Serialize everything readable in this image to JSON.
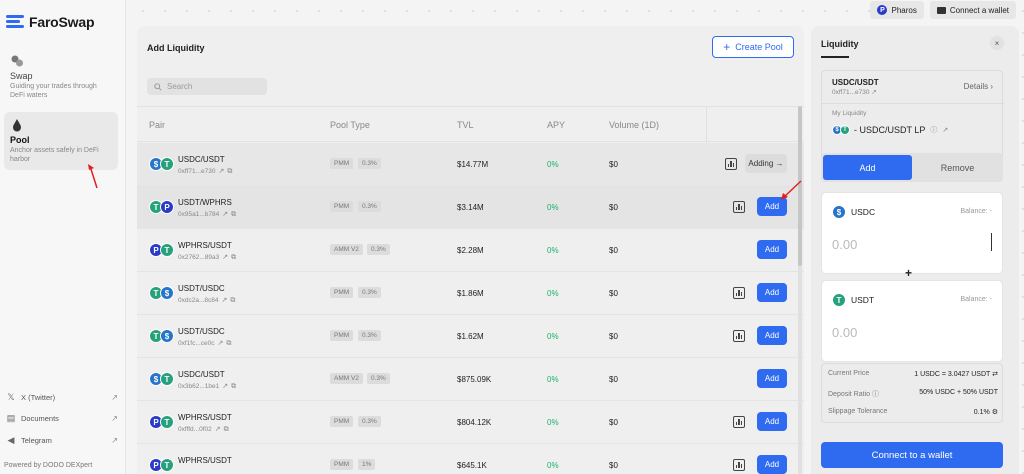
{
  "brand": {
    "name": "FaroSwap"
  },
  "sidebar": {
    "nav": [
      {
        "title": "Swap",
        "desc": "Guiding your trades through DeFi waters"
      },
      {
        "title": "Pool",
        "desc": "Anchor assets safely in DeFi harbor"
      }
    ],
    "links": [
      {
        "label": "X (Twitter)",
        "icon": "x-icon"
      },
      {
        "label": "Documents",
        "icon": "document-icon"
      },
      {
        "label": "Telegram",
        "icon": "telegram-icon"
      }
    ],
    "powered": "Powered by DODO DEXpert"
  },
  "topbar": {
    "network": "Pharos",
    "connect": "Connect a wallet"
  },
  "main": {
    "title": "Add Liquidity",
    "create_pool": "Create Pool",
    "search_placeholder": "Search",
    "columns": {
      "pair": "Pair",
      "pool_type": "Pool Type",
      "tvl": "TVL",
      "apy": "APY",
      "volume": "Volume (1D)"
    },
    "rows": [
      {
        "pair": "USDC/USDT",
        "addr": "0xff71...e730",
        "type": "PMM",
        "fee": "0.3%",
        "tvl": "$14.77M",
        "apy": "0%",
        "vol": "$0",
        "action": "Adding →"
      },
      {
        "pair": "USDT/WPHRS",
        "addr": "0x95a1...b784",
        "type": "PMM",
        "fee": "0.3%",
        "tvl": "$3.14M",
        "apy": "0%",
        "vol": "$0",
        "action": "Add"
      },
      {
        "pair": "WPHRS/USDT",
        "addr": "0x2762...89a3",
        "type": "AMM V2",
        "fee": "0.3%",
        "tvl": "$2.28M",
        "apy": "0%",
        "vol": "$0",
        "action": "Add"
      },
      {
        "pair": "USDT/USDC",
        "addr": "0xdc2a...8c84",
        "type": "PMM",
        "fee": "0.3%",
        "tvl": "$1.86M",
        "apy": "0%",
        "vol": "$0",
        "action": "Add"
      },
      {
        "pair": "USDT/USDC",
        "addr": "0xf1fc...ce0c",
        "type": "PMM",
        "fee": "0.3%",
        "tvl": "$1.62M",
        "apy": "0%",
        "vol": "$0",
        "action": "Add"
      },
      {
        "pair": "USDC/USDT",
        "addr": "0x3b62...1be1",
        "type": "AMM V2",
        "fee": "0.3%",
        "tvl": "$875.09K",
        "apy": "0%",
        "vol": "$0",
        "action": "Add"
      },
      {
        "pair": "WPHRS/USDT",
        "addr": "0xfffd...0f02",
        "type": "PMM",
        "fee": "0.3%",
        "tvl": "$804.12K",
        "apy": "0%",
        "vol": "$0",
        "action": "Add"
      },
      {
        "pair": "WPHRS/USDT",
        "addr": "",
        "type": "PMM",
        "fee": "1%",
        "tvl": "$645.1K",
        "apy": "0%",
        "vol": "$0",
        "action": "Add"
      }
    ]
  },
  "liquidity": {
    "title": "Liquidity",
    "close": "×",
    "pool_name": "USDC/USDT",
    "pool_addr": "0xff71...e730",
    "details": "Details ›",
    "my_liquidity_label": "My Liquidity",
    "lp_label": "- USDC/USDT LP",
    "tab_add": "Add",
    "tab_remove": "Remove",
    "token_a": {
      "symbol": "USDC",
      "balance": "Balance: -",
      "amount": "0.00"
    },
    "plus": "+",
    "token_b": {
      "symbol": "USDT",
      "balance": "Balance: -",
      "amount": "0.00"
    },
    "current_price_label": "Current Price",
    "current_price": "1 USDC = 3.0427 USDT",
    "deposit_ratio_label": "Deposit Ratio",
    "deposit_ratio": "50% USDC + 50% USDT",
    "slippage_label": "Slippage Tolerance",
    "slippage": "0.1%",
    "connect": "Connect to a wallet"
  },
  "colors": {
    "accent": "#2f6bf0",
    "apy_green": "#19b36b",
    "usdc": "#2775ca",
    "usdt": "#26a17b",
    "wphrs": "#2b3bc8",
    "annotation_arrow": "#e02020"
  }
}
